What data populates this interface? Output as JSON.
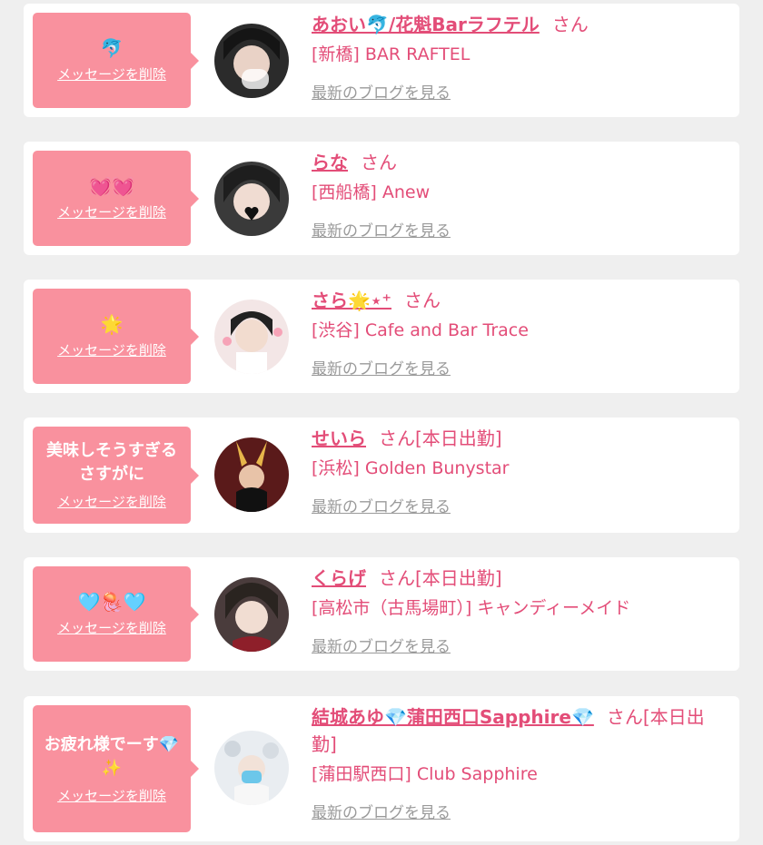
{
  "delete_label": "メッセージを削除",
  "blog_label": "最新のブログを見る",
  "san_label": "さん",
  "items": [
    {
      "message": "",
      "message_emoji": "🐬",
      "name": "あおい🐬/花魁Barラフテル",
      "san_suffix": "さん",
      "shop": "[新橋] BAR RAFTEL"
    },
    {
      "message": "",
      "message_emoji": "💓💓",
      "name": "らな",
      "san_suffix": "さん",
      "shop": "[西船橋] Anew"
    },
    {
      "message": "",
      "message_emoji": "🌟",
      "name": "さら🌟⋆⁺",
      "san_suffix": "さん",
      "shop": "[渋谷] Cafe and Bar Trace"
    },
    {
      "message": "美味しそうすぎるさすがに",
      "message_emoji": "",
      "name": "せいら",
      "san_suffix": "さん[本日出勤]",
      "shop": "[浜松] Golden Bunystar"
    },
    {
      "message": "",
      "message_emoji": "🩵🪼🩵",
      "name": "くらげ",
      "san_suffix": "さん[本日出勤]",
      "shop": "[高松市（古馬場町）] キャンディーメイド"
    },
    {
      "message": "お疲れ様でーす💎✨",
      "message_emoji": "",
      "name": "結城あゆ💎蒲田西口Sapphire💎",
      "san_suffix": "さん[本日出勤]",
      "shop": "[蒲田駅西口] Club Sapphire"
    }
  ],
  "colors": {
    "accent": "#e34d78",
    "bubble": "#f9919e",
    "link_gray": "#9a9a9a",
    "background": "#efefef"
  }
}
